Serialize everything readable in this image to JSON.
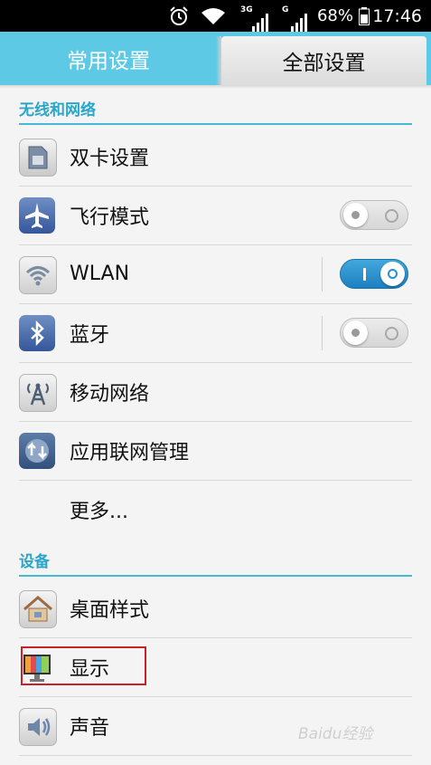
{
  "status_bar": {
    "time": "17:46",
    "battery_percent": "68%",
    "network_1": "3G",
    "network_2": "G",
    "icons": [
      "alarm-icon",
      "wifi-icon",
      "signal-icon",
      "battery-icon"
    ]
  },
  "tabs": [
    {
      "label": "常用设置",
      "selected": false
    },
    {
      "label": "全部设置",
      "selected": true
    }
  ],
  "sections": {
    "wireless": "无线和网络",
    "device": "设备"
  },
  "items": {
    "dual_sim": {
      "label": "双卡设置",
      "icon": "sim-card-icon"
    },
    "airplane": {
      "label": "飞行模式",
      "icon": "airplane-icon",
      "toggle": "off"
    },
    "wlan": {
      "label": "WLAN",
      "icon": "wifi-icon",
      "toggle": "on"
    },
    "bluetooth": {
      "label": "蓝牙",
      "icon": "bluetooth-icon",
      "toggle": "off"
    },
    "mobile": {
      "label": "移动网络",
      "icon": "antenna-icon"
    },
    "app_net": {
      "label": "应用联网管理",
      "icon": "network-manage-icon"
    },
    "more": {
      "label": "更多..."
    },
    "home": {
      "label": "桌面样式",
      "icon": "home-icon"
    },
    "display": {
      "label": "显示",
      "icon": "display-icon"
    },
    "sound": {
      "label": "声音",
      "icon": "speaker-icon"
    }
  },
  "watermark": "Baidu经验",
  "colors": {
    "accent": "#5ec9e4",
    "section_text": "#2aa6c9",
    "toggle_on": "#2a8fd0",
    "highlight": "#cc1f2a"
  }
}
